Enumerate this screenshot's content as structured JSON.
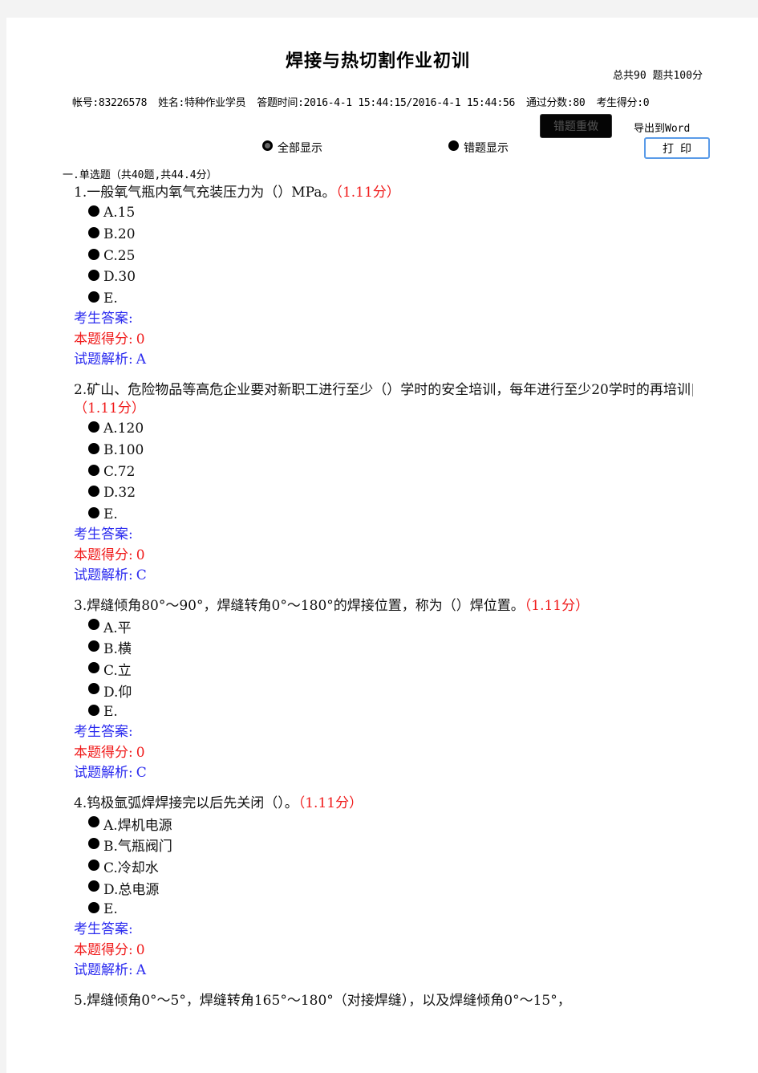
{
  "header": {
    "title": "焊接与热切割作业初训",
    "total": "总共90 题共100分",
    "info": {
      "account": "帐号:83226578",
      "name": "姓名:特种作业学员",
      "time": "答题时间:2016-4-1 15:44:15/2016-4-1 15:44:56",
      "pass_score": "通过分数:80",
      "score": "考生得分:0"
    }
  },
  "toolbar": {
    "redo_wrong_label": "错题重做",
    "export_word_label": "导出到Word",
    "print_label": "打印",
    "show_all_label": "全部显示",
    "show_wrong_label": "错题显示",
    "selected_filter": "全部显示"
  },
  "section": {
    "heading": "一.单选题（共40题,共44.4分）"
  },
  "labels": {
    "candidate_answer": "考生答案:",
    "question_score": "本题得分:",
    "analysis": "试题解析:"
  },
  "questions": [
    {
      "number": "1.",
      "stem": "一般氧气瓶内氧气充装压力为（）MPa。",
      "score": "（1.11分）",
      "options": [
        "A.15",
        "B.20",
        "C.25",
        "D.30",
        "E."
      ],
      "candidate_answer": "",
      "question_score": "0",
      "analysis": "A"
    },
    {
      "number": "2.",
      "stem": "矿山、危险物品等高危企业要对新职工进行至少（）学时的安全培训，每年进行至少20学时的再培训",
      "score": "（1.11分）",
      "options": [
        "A.120",
        "B.100",
        "C.72",
        "D.32",
        "E."
      ],
      "candidate_answer": "",
      "question_score": "0",
      "analysis": "C"
    },
    {
      "number": "3.",
      "stem": "焊缝倾角80°～90°，焊缝转角0°～180°的焊接位置，称为（）焊位置。",
      "score": "（1.11分）",
      "options": [
        "A.平",
        "B.横",
        "C.立",
        "D.仰",
        "E."
      ],
      "candidate_answer": "",
      "question_score": "0",
      "analysis": "C"
    },
    {
      "number": "4.",
      "stem": "钨极氩弧焊焊接完以后先关闭（）。",
      "score": "（1.11分）",
      "options": [
        "A.焊机电源",
        "B.气瓶阀门",
        "C.冷却水",
        "D.总电源",
        "E."
      ],
      "candidate_answer": "",
      "question_score": "0",
      "analysis": "A"
    },
    {
      "number": "5.",
      "stem": "焊缝倾角0°～5°，焊缝转角165°～180°（对接焊缝），以及焊缝倾角0°～15°，",
      "score": ""
    }
  ]
}
